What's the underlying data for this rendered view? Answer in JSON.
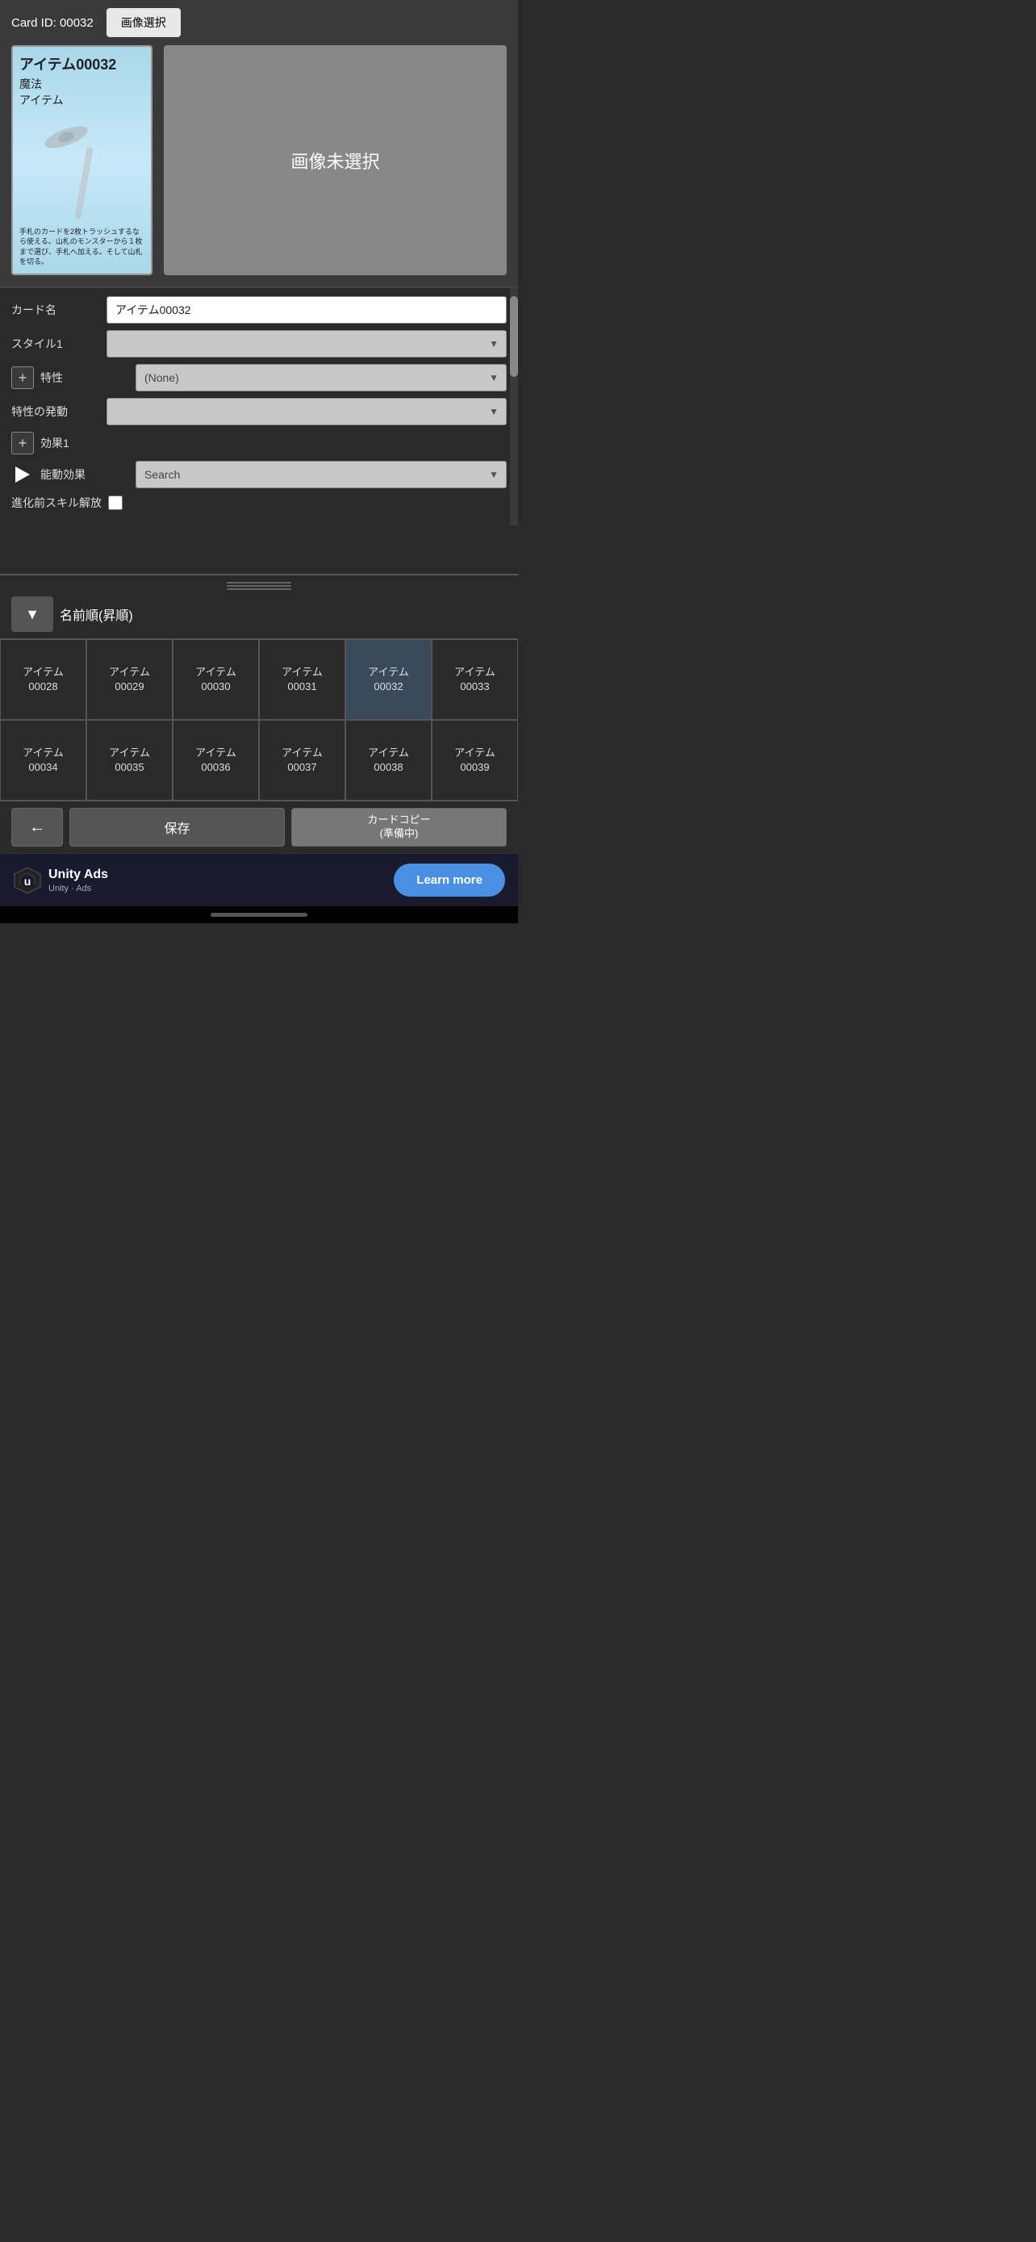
{
  "header": {
    "card_id_label": "Card ID: 00032",
    "image_select_btn": "画像選択"
  },
  "card_preview": {
    "title": "アイテム00032",
    "type1": "魔法",
    "type2": "アイテム",
    "description": "手札のカードを2枚トラッシュするなら使える。山札のモンスターから１枚まで選び、手札へ加える。そして山札を切る。"
  },
  "no_image": {
    "text": "画像未選択"
  },
  "form": {
    "card_name_label": "カード名",
    "card_name_value": "アイテム00032",
    "style1_label": "スタイル1",
    "style1_value": "",
    "trait_label": "特性",
    "trait_value": "(None)",
    "trait_trigger_label": "特性の発動",
    "trait_trigger_value": "",
    "effect1_label": "効果1",
    "active_effect_label": "能動効果",
    "active_effect_placeholder": "Search",
    "pre_skill_label": "進化前スキル解放"
  },
  "sort": {
    "btn_label": "▼",
    "sort_label": "名前順(昇順)"
  },
  "grid_items": [
    {
      "id": "アイテム\n00028"
    },
    {
      "id": "アイテム\n00029"
    },
    {
      "id": "アイテム\n00030"
    },
    {
      "id": "アイテム\n00031"
    },
    {
      "id": "アイテム\n00032"
    },
    {
      "id": "アイテム\n00033"
    },
    {
      "id": "アイテム\n00034"
    },
    {
      "id": "アイテム\n00035"
    },
    {
      "id": "アイテム\n00036"
    },
    {
      "id": "アイテム\n00037"
    },
    {
      "id": "アイテム\n00038"
    },
    {
      "id": "アイテム\n00039"
    }
  ],
  "bottom_actions": {
    "back_btn": "←",
    "save_btn": "保存",
    "copy_btn_line1": "カードコピー",
    "copy_btn_line2": "(準備中)"
  },
  "ads": {
    "brand": "Unity Ads",
    "sub": "Unity · Ads",
    "learn_more": "Learn more"
  }
}
